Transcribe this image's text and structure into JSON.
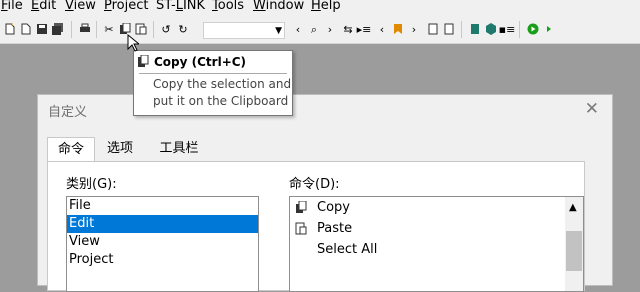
{
  "menubar": {
    "items": [
      {
        "pre": "",
        "ul": "F",
        "post": "ile"
      },
      {
        "pre": "",
        "ul": "E",
        "post": "dit"
      },
      {
        "pre": "",
        "ul": "V",
        "post": "iew"
      },
      {
        "pre": "",
        "ul": "P",
        "post": "roject"
      },
      {
        "pre": "ST-",
        "ul": "L",
        "post": "INK"
      },
      {
        "pre": "",
        "ul": "T",
        "post": "ools"
      },
      {
        "pre": "",
        "ul": "W",
        "post": "indow"
      },
      {
        "pre": "",
        "ul": "H",
        "post": "elp"
      }
    ]
  },
  "toolbar": {
    "combo_value": "",
    "colors": {
      "run": "#1a9e1a",
      "stop": "#c03030",
      "bookmark": "#1f7a6e",
      "warning": "#e08a00"
    }
  },
  "tooltip": {
    "title": "Copy (Ctrl+C)",
    "line1": "Copy the selection and",
    "line2": "put it on the Clipboard"
  },
  "dialog": {
    "title": "自定义",
    "close": "✕",
    "tabs": [
      "命令",
      "选项",
      "工具栏"
    ],
    "active_tab": "命令",
    "categories_label": "类别(G):",
    "commands_label": "命令(D):",
    "categories": [
      "File",
      "Edit",
      "View",
      "Project"
    ],
    "selected_category": "Edit",
    "commands": [
      "Copy",
      "Paste",
      "Select All"
    ]
  },
  "colors": {
    "selection": "#0078d7",
    "dialog_bg": "#f0f0f0"
  }
}
